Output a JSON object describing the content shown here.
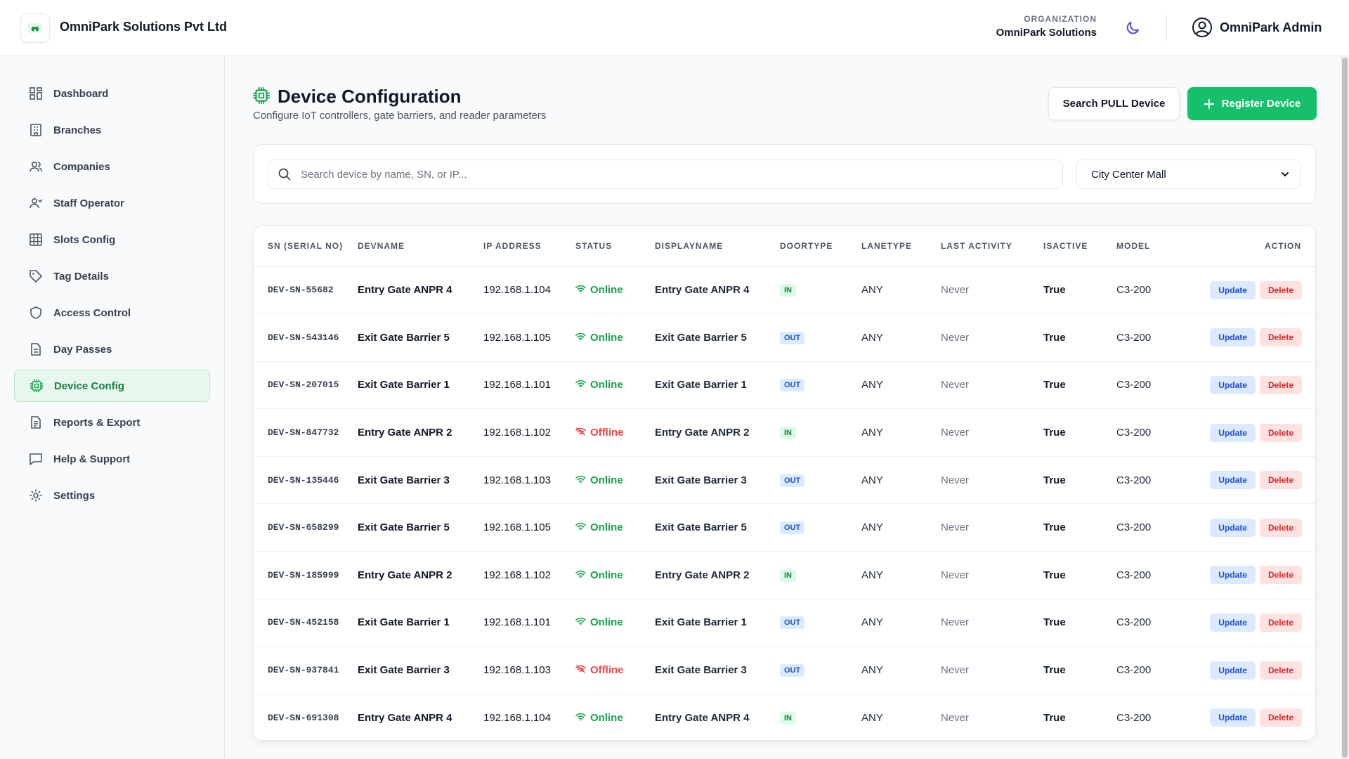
{
  "header": {
    "company_name": "OmniPark Solutions Pvt Ltd",
    "org_label": "ORGANIZATION",
    "org_name": "OmniPark Solutions",
    "user_name": "OmniPark Admin"
  },
  "sidebar": {
    "items": [
      {
        "label": "Dashboard",
        "icon": "dashboard-icon"
      },
      {
        "label": "Branches",
        "icon": "building-icon"
      },
      {
        "label": "Companies",
        "icon": "users-icon"
      },
      {
        "label": "Staff Operator",
        "icon": "user-icon"
      },
      {
        "label": "Slots Config",
        "icon": "grid-icon"
      },
      {
        "label": "Tag Details",
        "icon": "tag-icon"
      },
      {
        "label": "Access Control",
        "icon": "shield-icon"
      },
      {
        "label": "Day Passes",
        "icon": "document-icon"
      },
      {
        "label": "Device Config",
        "icon": "chip-icon",
        "active": true
      },
      {
        "label": "Reports & Export",
        "icon": "report-icon"
      },
      {
        "label": "Help & Support",
        "icon": "message-icon"
      },
      {
        "label": "Settings",
        "icon": "gear-icon"
      }
    ]
  },
  "page": {
    "title": "Device Configuration",
    "subtitle": "Configure IoT controllers, gate barriers, and reader parameters",
    "search_pull_label": "Search PULL Device",
    "register_label": "Register Device"
  },
  "filters": {
    "search_placeholder": "Search device by name, SN, or IP...",
    "branch_selected": "City Center Mall"
  },
  "table": {
    "headers": [
      "SN (SERIAL NO)",
      "DEVNAME",
      "IP ADDRESS",
      "STATUS",
      "DISPLAYNAME",
      "DOORTYPE",
      "LANETYPE",
      "LAST ACTIVITY",
      "ISACTIVE",
      "MODEL",
      "ACTION"
    ],
    "update_label": "Update",
    "delete_label": "Delete",
    "rows": [
      {
        "sn": "DEV-SN-55682",
        "devname": "Entry Gate ANPR 4",
        "ip": "192.168.1.104",
        "status": "Online",
        "displayname": "Entry Gate ANPR 4",
        "door": "IN",
        "lane": "ANY",
        "last": "Never",
        "active": "True",
        "model": "C3-200"
      },
      {
        "sn": "DEV-SN-543146",
        "devname": "Exit Gate Barrier 5",
        "ip": "192.168.1.105",
        "status": "Online",
        "displayname": "Exit Gate Barrier 5",
        "door": "OUT",
        "lane": "ANY",
        "last": "Never",
        "active": "True",
        "model": "C3-200"
      },
      {
        "sn": "DEV-SN-207015",
        "devname": "Exit Gate Barrier 1",
        "ip": "192.168.1.101",
        "status": "Online",
        "displayname": "Exit Gate Barrier 1",
        "door": "OUT",
        "lane": "ANY",
        "last": "Never",
        "active": "True",
        "model": "C3-200"
      },
      {
        "sn": "DEV-SN-847732",
        "devname": "Entry Gate ANPR 2",
        "ip": "192.168.1.102",
        "status": "Offline",
        "displayname": "Entry Gate ANPR 2",
        "door": "IN",
        "lane": "ANY",
        "last": "Never",
        "active": "True",
        "model": "C3-200"
      },
      {
        "sn": "DEV-SN-135446",
        "devname": "Exit Gate Barrier 3",
        "ip": "192.168.1.103",
        "status": "Online",
        "displayname": "Exit Gate Barrier 3",
        "door": "OUT",
        "lane": "ANY",
        "last": "Never",
        "active": "True",
        "model": "C3-200"
      },
      {
        "sn": "DEV-SN-658299",
        "devname": "Exit Gate Barrier 5",
        "ip": "192.168.1.105",
        "status": "Online",
        "displayname": "Exit Gate Barrier 5",
        "door": "OUT",
        "lane": "ANY",
        "last": "Never",
        "active": "True",
        "model": "C3-200"
      },
      {
        "sn": "DEV-SN-185999",
        "devname": "Entry Gate ANPR 2",
        "ip": "192.168.1.102",
        "status": "Online",
        "displayname": "Entry Gate ANPR 2",
        "door": "IN",
        "lane": "ANY",
        "last": "Never",
        "active": "True",
        "model": "C3-200"
      },
      {
        "sn": "DEV-SN-452158",
        "devname": "Exit Gate Barrier 1",
        "ip": "192.168.1.101",
        "status": "Online",
        "displayname": "Exit Gate Barrier 1",
        "door": "OUT",
        "lane": "ANY",
        "last": "Never",
        "active": "True",
        "model": "C3-200"
      },
      {
        "sn": "DEV-SN-937841",
        "devname": "Exit Gate Barrier 3",
        "ip": "192.168.1.103",
        "status": "Offline",
        "displayname": "Exit Gate Barrier 3",
        "door": "OUT",
        "lane": "ANY",
        "last": "Never",
        "active": "True",
        "model": "C3-200"
      },
      {
        "sn": "DEV-SN-691308",
        "devname": "Entry Gate ANPR 4",
        "ip": "192.168.1.104",
        "status": "Online",
        "displayname": "Entry Gate ANPR 4",
        "door": "IN",
        "lane": "ANY",
        "last": "Never",
        "active": "True",
        "model": "C3-200"
      }
    ]
  },
  "colors": {
    "accent": "#16c06a",
    "online": "#16a34a",
    "offline": "#ef4444",
    "in_badge": "#dcfce7",
    "out_badge": "#dbeafe"
  }
}
